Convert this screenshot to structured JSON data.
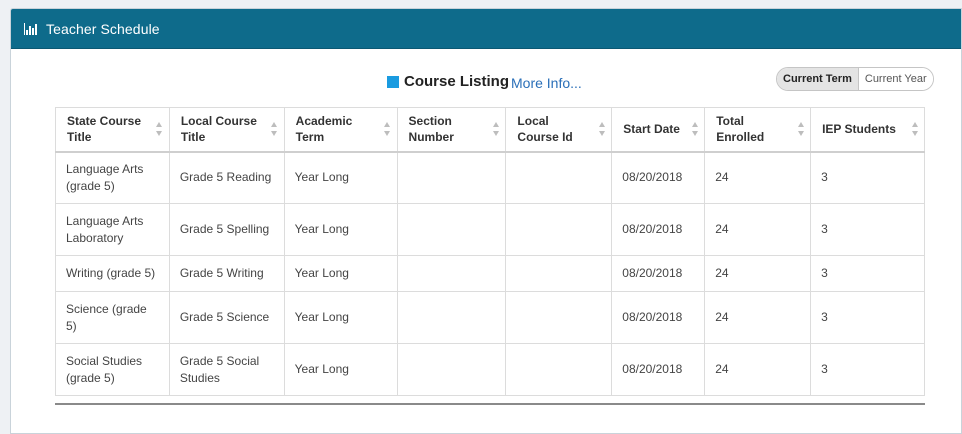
{
  "header": {
    "icon": "bar-chart-icon",
    "title": "Teacher Schedule"
  },
  "listing": {
    "legend_color": "#1a9be0",
    "label": "Course Listing",
    "more_info": "More Info..."
  },
  "term_toggle": {
    "options": [
      "Current Term",
      "Current Year"
    ],
    "selected": "Current Term"
  },
  "table": {
    "columns": [
      "State Course Title",
      "Local Course Title",
      "Academic Term",
      "Section Number",
      "Local Course Id",
      "Start Date",
      "Total Enrolled",
      "IEP Students"
    ],
    "rows": [
      [
        "Language Arts (grade 5)",
        "Grade 5 Reading",
        "Year Long",
        "",
        "",
        "08/20/2018",
        "24",
        "3"
      ],
      [
        "Language Arts Laboratory",
        "Grade 5 Spelling",
        "Year Long",
        "",
        "",
        "08/20/2018",
        "24",
        "3"
      ],
      [
        "Writing (grade 5)",
        "Grade 5 Writing",
        "Year Long",
        "",
        "",
        "08/20/2018",
        "24",
        "3"
      ],
      [
        "Science (grade 5)",
        "Grade 5 Science",
        "Year Long",
        "",
        "",
        "08/20/2018",
        "24",
        "3"
      ],
      [
        "Social Studies (grade 5)",
        "Grade 5 Social Studies",
        "Year Long",
        "",
        "",
        "08/20/2018",
        "24",
        "3"
      ]
    ]
  },
  "colors": {
    "header_bg": "#0e6b8b",
    "link": "#2a6fb8"
  }
}
